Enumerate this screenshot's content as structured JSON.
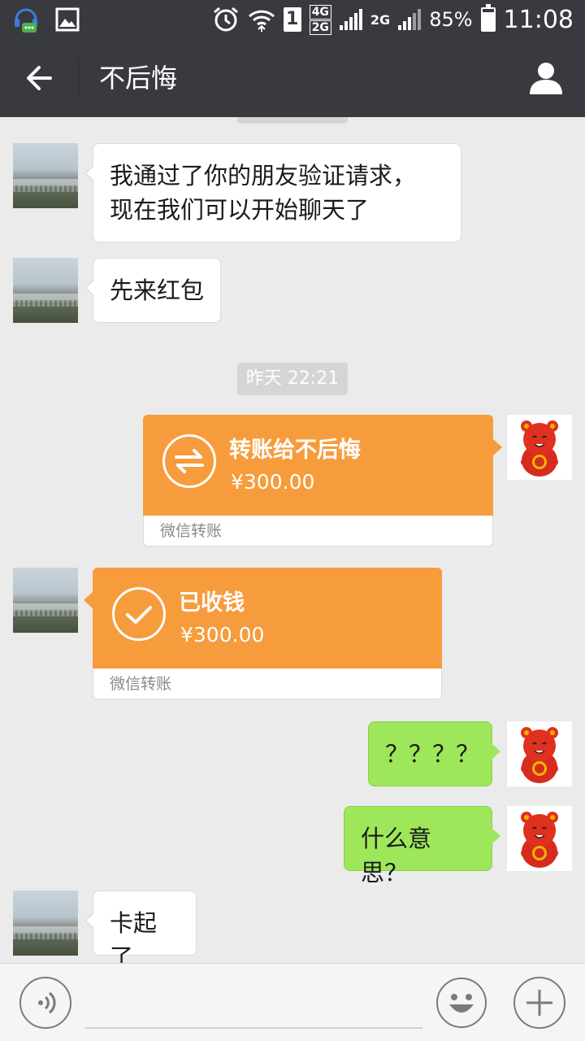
{
  "status_bar": {
    "battery_percent": "85%",
    "time": "11:08",
    "sim_slot": "1",
    "network_4g": "4G",
    "network_2g_top": "2G",
    "network_2g": "2G"
  },
  "nav": {
    "title": "不后悔"
  },
  "messages": [
    {
      "side": "in",
      "text_line1": "我通过了你的朋友验证请求，",
      "text_line2": "现在我们可以开始聊天了"
    },
    {
      "side": "in",
      "text": "先来红包"
    },
    {
      "timestamp": "昨天 22:21"
    },
    {
      "side": "out",
      "type": "transfer",
      "title": "转账给不后悔",
      "amount": "¥300.00",
      "footer": "微信转账"
    },
    {
      "side": "in",
      "type": "transfer",
      "title": "已收钱",
      "amount": "¥300.00",
      "footer": "微信转账"
    },
    {
      "side": "out",
      "text": "？？？？"
    },
    {
      "side": "out",
      "text": "什么意思？"
    },
    {
      "side": "in",
      "text": "卡起了"
    }
  ],
  "colors": {
    "title_bar": "#393a3f",
    "chat_bg": "#ebebeb",
    "outgoing_bubble": "#9ee75a",
    "transfer_orange": "#f79c3c"
  },
  "icons": {
    "back": "arrow-left-icon",
    "contact": "person-icon",
    "transfer_sent": "transfer-arrows-icon",
    "transfer_received": "checkmark-icon",
    "voice": "voice-icon",
    "emoji": "emoji-icon",
    "more": "plus-icon"
  }
}
